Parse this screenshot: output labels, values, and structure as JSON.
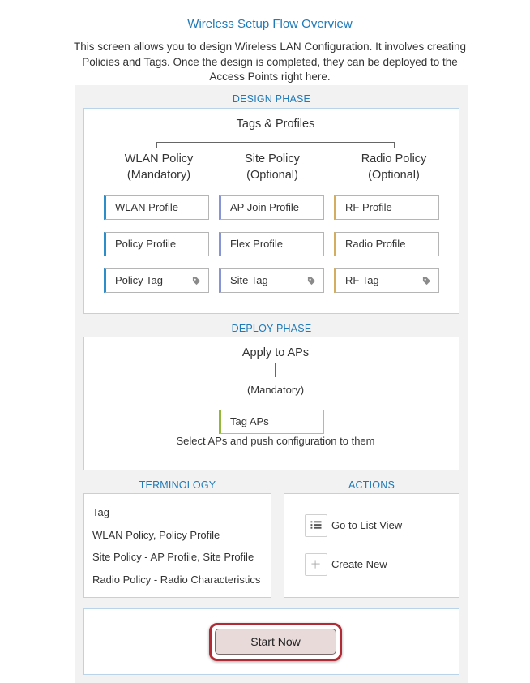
{
  "title": "Wireless Setup Flow Overview",
  "intro": "This screen allows you to design Wireless LAN Configuration. It involves creating Policies and Tags. Once the design is completed, they can be deployed to the Access Points right here.",
  "design": {
    "heading": "DESIGN PHASE",
    "root": "Tags & Profiles",
    "columns": [
      {
        "title": "WLAN Policy",
        "subtitle": "(Mandatory)",
        "items": [
          "WLAN Profile",
          "Policy Profile",
          "Policy Tag"
        ],
        "color": "#2d8dc8"
      },
      {
        "title": "Site Policy",
        "subtitle": "(Optional)",
        "items": [
          "AP Join Profile",
          "Flex Profile",
          "Site Tag"
        ],
        "color": "#8795d6"
      },
      {
        "title": "Radio Policy",
        "subtitle": "(Optional)",
        "items": [
          "RF Profile",
          "Radio Profile",
          "RF Tag"
        ],
        "color": "#d4ae60"
      }
    ]
  },
  "deploy": {
    "heading": "DEPLOY PHASE",
    "root": "Apply to APs",
    "subtitle": "(Mandatory)",
    "item": "Tag APs",
    "item_color": "#93b73a",
    "description": "Select APs and push configuration to them"
  },
  "terminology": {
    "heading": "TERMINOLOGY",
    "lines": [
      "Tag",
      "WLAN Policy, Policy Profile",
      "Site Policy - AP Profile, Site Profile",
      "Radio Policy - Radio Characteristics"
    ]
  },
  "actions": {
    "heading": "ACTIONS",
    "list_view": {
      "label": "Go to List View",
      "icon": "list-icon"
    },
    "create_new": {
      "label": "Create New",
      "icon": "plus-icon"
    }
  },
  "start_button": "Start Now",
  "colors": {
    "accent": "#1f7ab8",
    "border": "#b9d4ea",
    "highlight": "#b22a33"
  }
}
